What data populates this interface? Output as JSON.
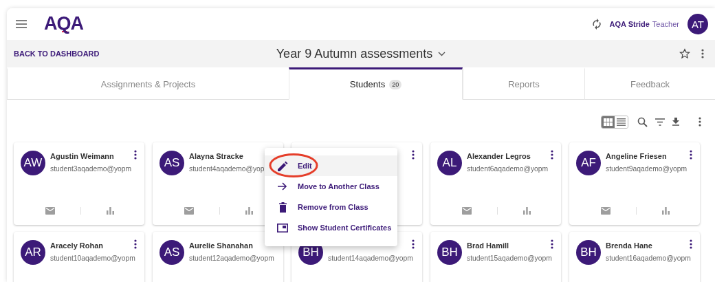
{
  "header": {
    "logo": "AQA",
    "product": "AQA Stride",
    "role": "Teacher",
    "avatar": "AT"
  },
  "subbar": {
    "back_link": "BACK TO DASHBOARD",
    "title": "Year 9 Autumn assessments"
  },
  "tabs": [
    {
      "label": "Assignments & Projects",
      "selected": false
    },
    {
      "label": "Students",
      "selected": true,
      "count": "20"
    },
    {
      "label": "Reports",
      "selected": false
    },
    {
      "label": "Feedback",
      "selected": false
    }
  ],
  "view_toggle": [
    {
      "kind": "grid",
      "selected": true
    },
    {
      "kind": "list",
      "selected": false
    }
  ],
  "students": [
    {
      "initials": "AW",
      "name": "Agustin Weimann",
      "email": "student3aqademo@yopm",
      "menu_icon": true,
      "footer": true
    },
    {
      "initials": "AS",
      "name": "Alayna Stracke",
      "email": "student4aqademo@yop",
      "menu_icon": false,
      "footer": true
    },
    {
      "menu_icon": true,
      "footer": false
    },
    {
      "initials": "AL",
      "name": "Alexander Legros",
      "email": "student6aqademo@yopm",
      "menu_icon": true,
      "footer": true
    },
    {
      "initials": "AF",
      "name": "Angeline Friesen",
      "email": "student9aqademo@yopm",
      "menu_icon": true,
      "footer": true
    },
    {
      "initials": "AR",
      "name": "Aracely Rohan",
      "email": "student10aqademo@yopm",
      "menu_icon": true,
      "footer": false
    },
    {
      "initials": "AS",
      "name": "Aurelie Shanahan",
      "email": "student12aqademo@yopm",
      "menu_icon": false,
      "footer": false
    },
    {
      "initials": "BH",
      "email": "student14aqademo@yopm",
      "menu_icon": true,
      "footer": false
    },
    {
      "initials": "BH",
      "name": "Brad Hamill",
      "email": "student15aqademo@yopm",
      "menu_icon": true,
      "footer": false
    },
    {
      "initials": "BH",
      "name": "Brenda Hane",
      "email": "student16aqademo@yopm",
      "menu_icon": true,
      "footer": false
    }
  ],
  "context_menu": {
    "items": [
      {
        "kind": "edit",
        "label": "Edit",
        "highlighted": true,
        "circled": true
      },
      {
        "kind": "move",
        "label": "Move to Another Class",
        "highlighted": false,
        "circled": false
      },
      {
        "kind": "remove",
        "label": "Remove from Class",
        "highlighted": false,
        "circled": false
      },
      {
        "kind": "certificates",
        "label": "Show Student Certificates",
        "highlighted": false,
        "circled": false
      }
    ]
  }
}
